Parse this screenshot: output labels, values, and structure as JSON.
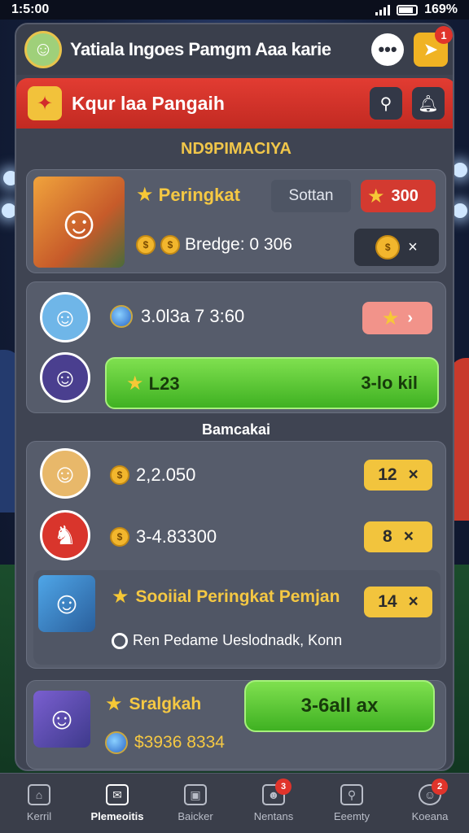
{
  "status_bar": {
    "time": "1:5:00",
    "battery": "169%"
  },
  "header": {
    "title": "Yatiala Ingoes Pamgm Aaa karie",
    "chat_glyph": "•••",
    "notif_badge": "1"
  },
  "red_bar": {
    "title": "Kqur laa Pangaih"
  },
  "section_ranking": {
    "label": "ND9PIMACIYA"
  },
  "profile": {
    "rank_label": "Peringkat",
    "sottan_label": "Sottan",
    "points": "300",
    "stat_text": "Bredge: 0 306",
    "bag_close": "×"
  },
  "friends": {
    "row1_text": "3.0l3a 7 3:60",
    "row1_action": "›",
    "green_left": "L23",
    "green_right": "3-lo kil"
  },
  "section_list": {
    "label": "Bamcakai"
  },
  "list": {
    "rows": [
      {
        "value": "2,2.050",
        "pill": "12",
        "close": "×"
      },
      {
        "value": "3-4.83300",
        "pill": "8",
        "close": "×"
      }
    ],
    "social": {
      "title": "Sooiial Peringkat Pemjan",
      "pill": "14",
      "close": "×",
      "sub": "Ren Pedame Ueslodnadk, Konn"
    }
  },
  "bottom_card": {
    "title": "Sralgkah",
    "money": "$3936 8334",
    "button": "3-6all ax"
  },
  "nav": {
    "items": [
      {
        "label": "Kerril"
      },
      {
        "label": "Plemeoitis"
      },
      {
        "label": "Baicker"
      },
      {
        "label": "Nentans",
        "badge": "3"
      },
      {
        "label": "Eeemty"
      },
      {
        "label": "Koeana",
        "badge": "2"
      }
    ]
  },
  "colors": {
    "accent_red": "#e23c32",
    "accent_yellow": "#f2c43d",
    "accent_green": "#3fb122",
    "panel": "#3f4452"
  }
}
